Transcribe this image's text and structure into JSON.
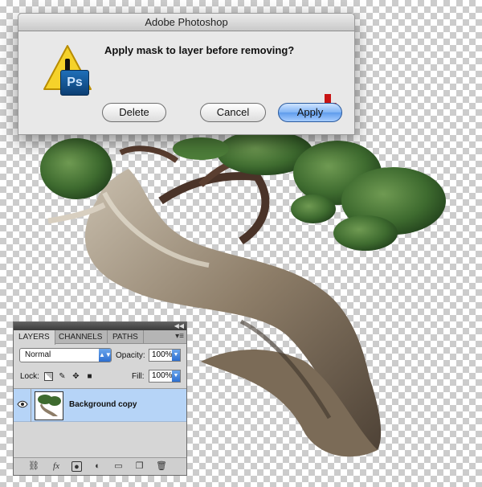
{
  "dialog": {
    "title": "Adobe Photoshop",
    "message": "Apply mask to layer before removing?",
    "app_badge": "Ps",
    "buttons": {
      "delete": "Delete",
      "cancel": "Cancel",
      "apply": "Apply"
    }
  },
  "layers_panel": {
    "tabs": [
      "LAYERS",
      "CHANNELS",
      "PATHS"
    ],
    "blend_mode": "Normal",
    "opacity_label": "Opacity:",
    "opacity_value": "100%",
    "lock_label": "Lock:",
    "fill_label": "Fill:",
    "fill_value": "100%",
    "layers": [
      {
        "name": "Background copy",
        "visible": true,
        "selected": true
      }
    ],
    "footer_icons": [
      "link-icon",
      "fx-icon",
      "mask-icon",
      "adjustment-icon",
      "folder-icon",
      "new-layer-icon",
      "trash-icon"
    ]
  },
  "colors": {
    "selection": "#b6d4f7",
    "accent_arrow": "#c81414",
    "apply_button": "#5f9cec"
  }
}
